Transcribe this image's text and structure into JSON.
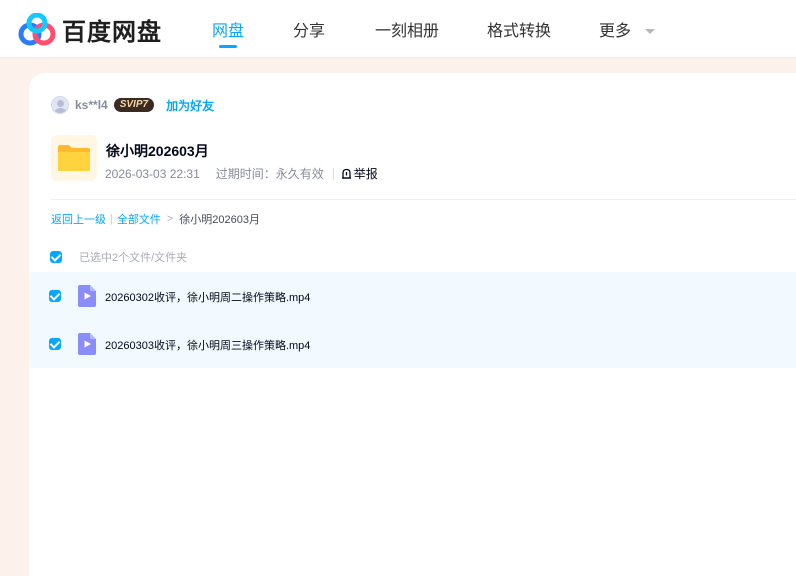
{
  "header": {
    "brand": "百度网盘",
    "nav": [
      {
        "label": "网盘",
        "active": true
      },
      {
        "label": "分享",
        "active": false
      },
      {
        "label": "一刻相册",
        "active": false
      },
      {
        "label": "格式转换",
        "active": false
      },
      {
        "label": "更多",
        "active": false,
        "has_dropdown": true
      }
    ]
  },
  "share": {
    "username": "ks**l4",
    "badge": "SVIP7",
    "add_friend": "加为好友",
    "folder_name": "徐小明202603月",
    "created": "2026-03-03 22:31",
    "expire": "过期时间：永久有效",
    "report": "举报"
  },
  "breadcrumb": {
    "back": "返回上一级",
    "sep": "|",
    "all_files": "全部文件",
    "arrow": ">",
    "current": "徐小明202603月"
  },
  "selection": {
    "label": "已选中2个文件/文件夹",
    "all_checked": true
  },
  "files": [
    {
      "name": "20260302收评，徐小明周二操作策略.mp4",
      "checked": true
    },
    {
      "name": "20260303收评，徐小明周三操作策略.mp4",
      "checked": true
    }
  ],
  "colors": {
    "accent": "#06a7ff",
    "page_bg": "#fdf1ec",
    "row_highlight": "#f2f9ff",
    "folder": "#ffc933",
    "video_icon": "#8a8cf7"
  },
  "icons": {
    "logo": "baidu-netdisk-logo",
    "folder": "folder-icon",
    "video": "video-file-icon",
    "report": "report-icon",
    "dropdown": "chevron-down-icon",
    "checkbox": "checkbox-checked-icon"
  }
}
